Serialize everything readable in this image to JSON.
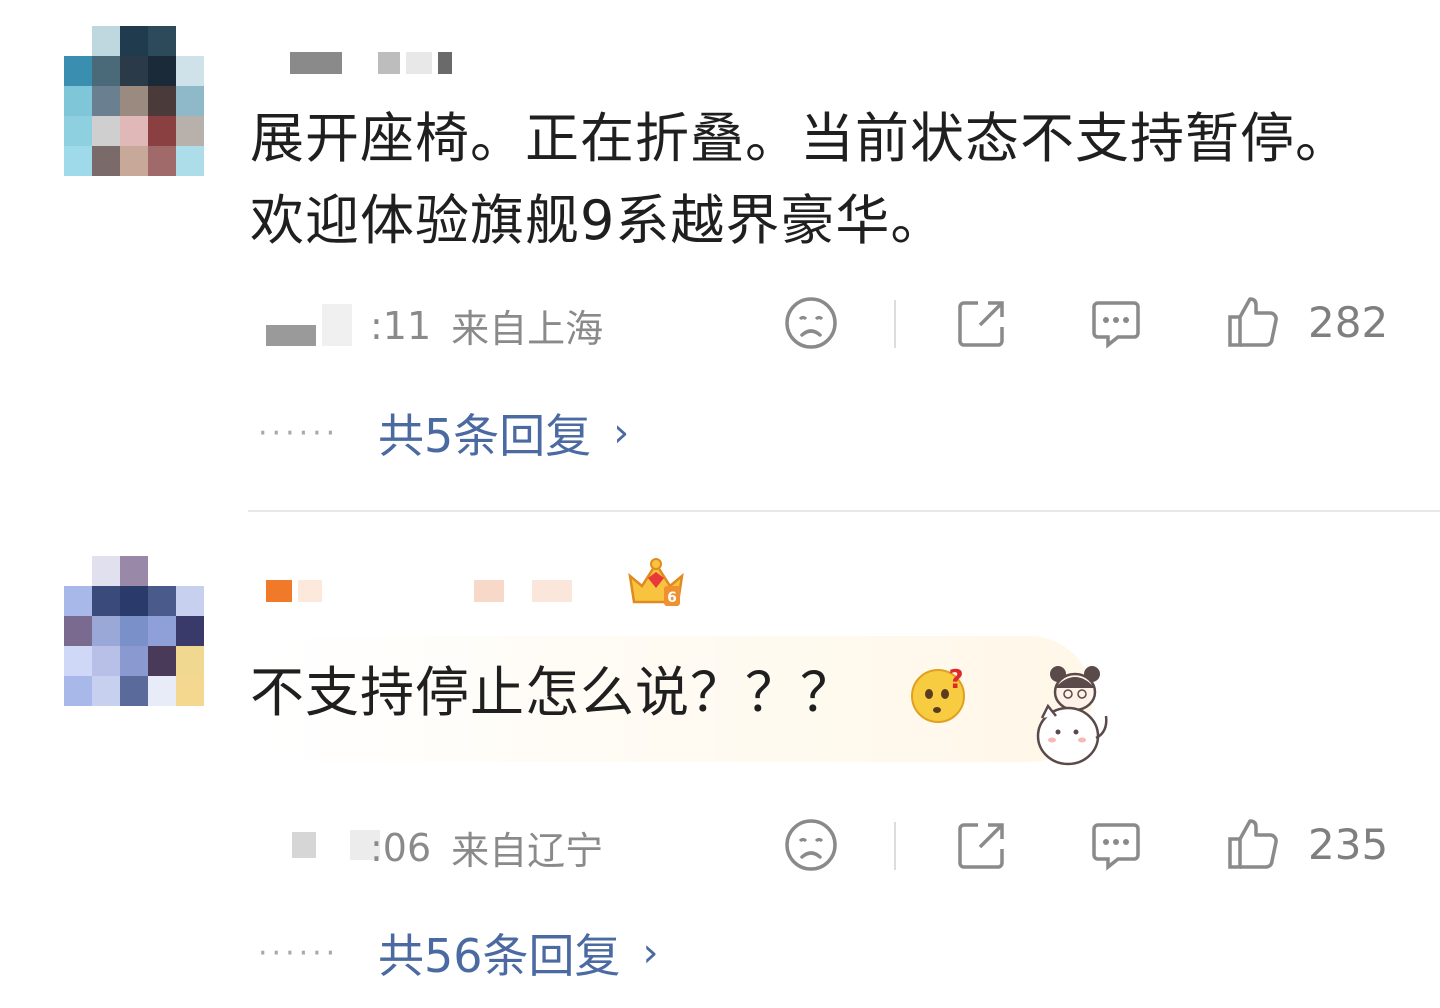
{
  "comments": [
    {
      "text": "展开座椅。正在折叠。当前状态不支持暂停。欢迎体验旗舰9系越界豪华。",
      "time": ":11",
      "location": "来自上海",
      "likes": "282",
      "replies": "共5条回复",
      "avatar_colors": [
        "#ffffff",
        "#bfd8e0",
        "#1f3b4d",
        "#2d4a5a",
        "#ffffff",
        "#3a8fb0",
        "#4a6a7a",
        "#2a3a48",
        "#1a2a38",
        "#cfe2ea",
        "#7ec6d8",
        "#6a8090",
        "#9a8a80",
        "#4a3a3a",
        "#8fb8c8",
        "#8fd0e0",
        "#cfcfcf",
        "#e0b8b8",
        "#8a4040",
        "#b8b0aa",
        "#9fdaea",
        "#7a6a6a",
        "#c8a898",
        "#a06a6a",
        "#aeddea"
      ]
    },
    {
      "text": "不支持停止怎么说？？？",
      "time": ":06",
      "location": "来自辽宁",
      "likes": "235",
      "replies": "共56条回复",
      "level": "6",
      "avatar_colors": [
        "#ffffff",
        "#e0e0ee",
        "#9a88a8",
        "#ffffff",
        "#ffffff",
        "#a8b8e8",
        "#3a4a7a",
        "#2a3a6a",
        "#4a5a8a",
        "#c8d0f0",
        "#7a6a90",
        "#9aa8d8",
        "#7a90c8",
        "#8fa0d8",
        "#3a3a6a",
        "#d0d8f8",
        "#b8c0e8",
        "#8a9ad0",
        "#4a3a5a",
        "#f0d890",
        "#a8b8e8",
        "#c8d0f0",
        "#5a6a9a",
        "#e8ecf8",
        "#f4d890"
      ]
    }
  ]
}
